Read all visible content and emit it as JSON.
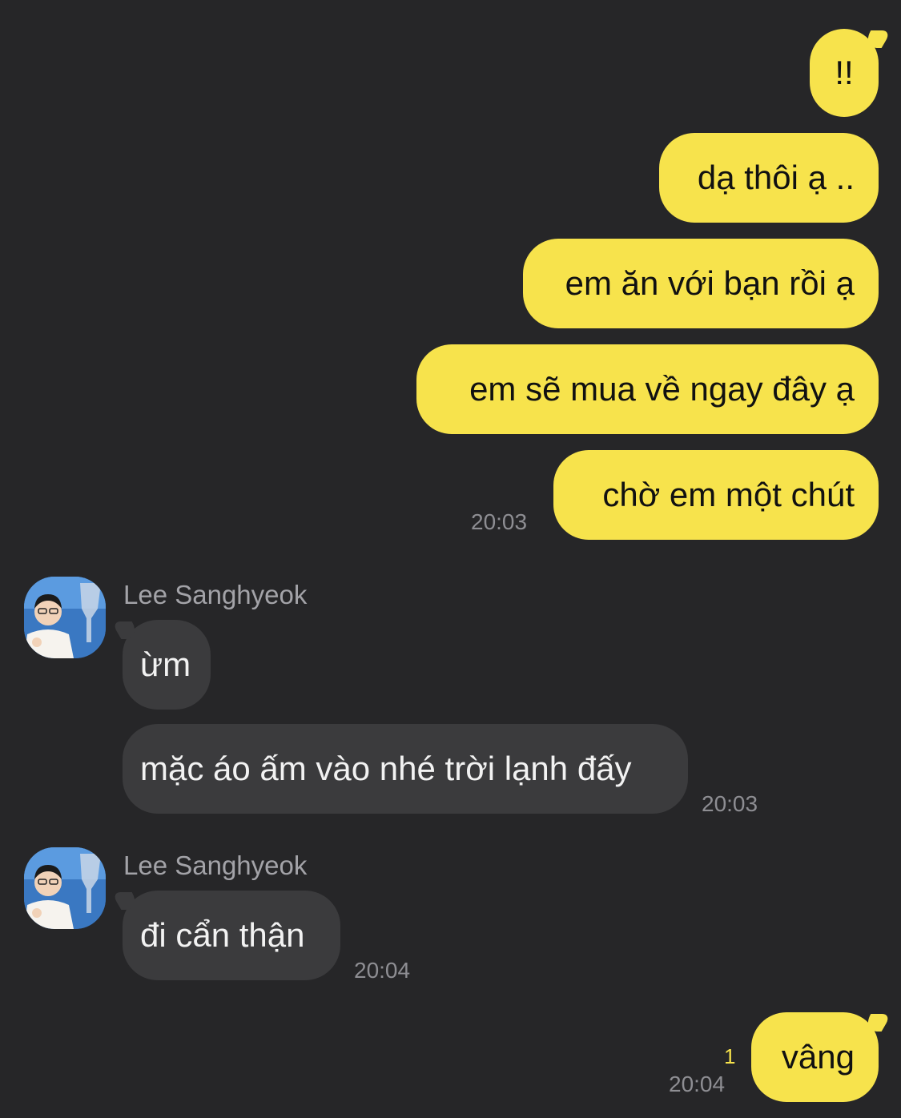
{
  "chat": {
    "colors": {
      "background": "#262628",
      "outgoing_bubble": "#f7e34c",
      "incoming_bubble": "#3b3b3d",
      "timestamp": "#8e8e93",
      "unread_count": "#f7e34c"
    },
    "outgoing_group_1": {
      "messages": [
        "!!",
        "dạ thôi ạ ..",
        "em ăn với bạn rồi ạ",
        "em sẽ mua về ngay đây ạ",
        "chờ em một chút"
      ],
      "time": "20:03"
    },
    "incoming_group_1": {
      "sender": "Lee Sanghyeok",
      "avatar_icon": "profile-photo-with-trophy",
      "messages": [
        "ừm",
        "mặc áo ấm vào nhé trời lạnh đấy"
      ],
      "time": "20:03"
    },
    "incoming_group_2": {
      "sender": "Lee Sanghyeok",
      "avatar_icon": "profile-photo-with-trophy",
      "messages": [
        "đi cẩn thận"
      ],
      "time": "20:04"
    },
    "outgoing_group_2": {
      "messages": [
        "vâng"
      ],
      "unread_count": "1",
      "time": "20:04"
    }
  }
}
